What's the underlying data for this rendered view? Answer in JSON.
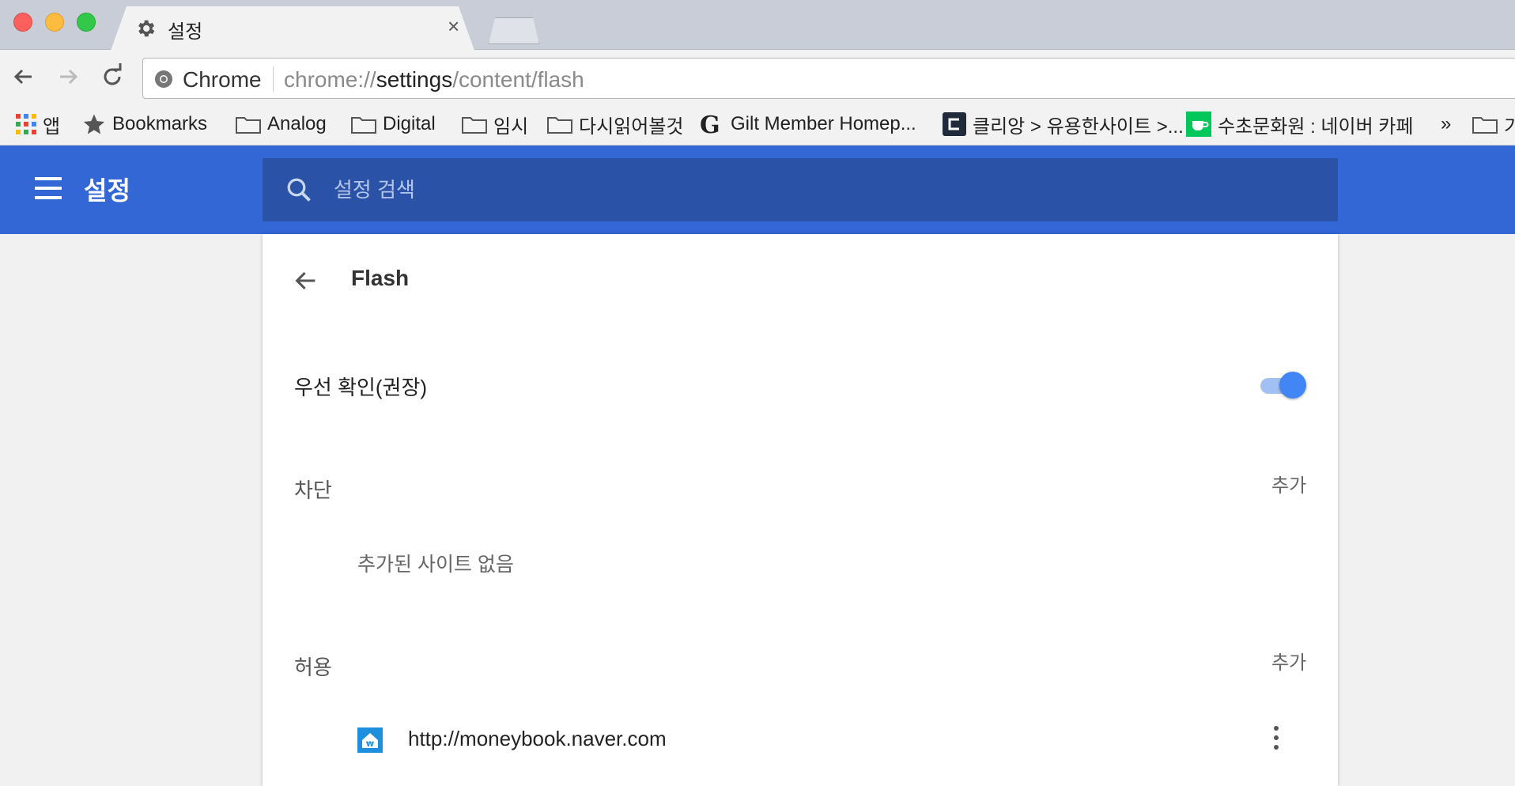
{
  "tab": {
    "title": "설정",
    "close": "×",
    "icon": "gear-icon"
  },
  "omnibox": {
    "chip_label": "Chrome",
    "scheme": "chrome://",
    "host": "settings",
    "path": "/content/flash"
  },
  "bookmarks": [
    {
      "label": "앱",
      "icon": "apps-grid-icon"
    },
    {
      "label": "Bookmarks",
      "icon": "star-icon"
    },
    {
      "label": "Analog",
      "icon": "folder-icon"
    },
    {
      "label": "Digital",
      "icon": "folder-icon"
    },
    {
      "label": "임시",
      "icon": "folder-icon"
    },
    {
      "label": "다시읽어볼것",
      "icon": "folder-icon"
    },
    {
      "label": "Gilt Member Homep...",
      "icon": "gilt-g-icon"
    },
    {
      "label": "클리앙 > 유용한사이트 >...",
      "icon": "clien-icon"
    },
    {
      "label": "수초문화원 : 네이버 카페",
      "icon": "naver-cafe-icon"
    },
    {
      "label": "»",
      "icon": "overflow-chevron-icon"
    },
    {
      "label": "기",
      "icon": "folder-icon"
    }
  ],
  "header": {
    "title": "설정",
    "search_placeholder": "설정 검색"
  },
  "page": {
    "title": "Flash",
    "ask_first_label": "우선 확인(권장)",
    "ask_first_enabled": true,
    "block_title": "차단",
    "block_add": "추가",
    "block_empty": "추가된 사이트 없음",
    "allow_title": "허용",
    "allow_add": "추가",
    "allow_sites": [
      {
        "url": "http://moneybook.naver.com",
        "icon": "site-favicon-icon"
      }
    ]
  },
  "colors": {
    "header": "#3367d6",
    "search": "#2a53a8",
    "toggle": "#4285f4"
  }
}
